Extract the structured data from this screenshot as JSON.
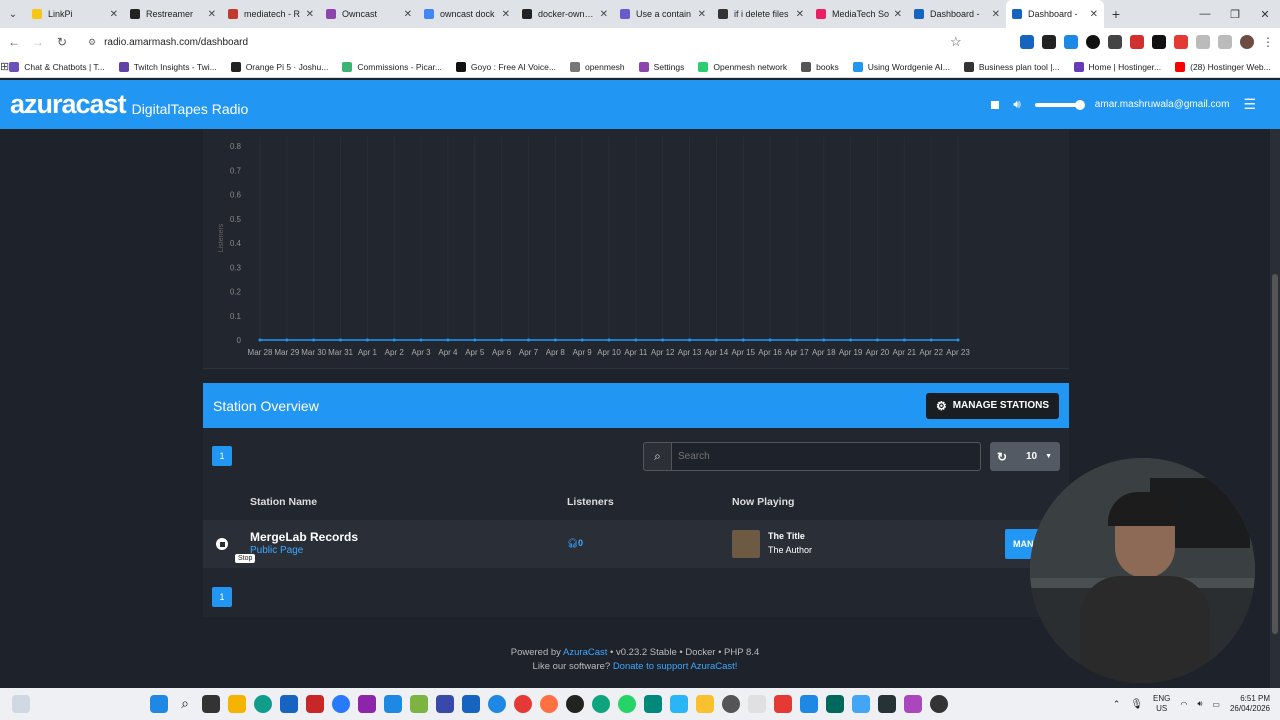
{
  "browser": {
    "tabs": [
      {
        "label": "LinkPi",
        "color": "#f5c518"
      },
      {
        "label": "Restreamer",
        "color": "#222222"
      },
      {
        "label": "mediatech - R",
        "color": "#c0392b"
      },
      {
        "label": "Owncast",
        "color": "#8e44ad"
      },
      {
        "label": "owncast dock",
        "color": "#4285f4"
      },
      {
        "label": "docker-owncast",
        "color": "#222222"
      },
      {
        "label": "Use a contain",
        "color": "#6a5acd"
      },
      {
        "label": "if i delete files",
        "color": "#333333"
      },
      {
        "label": "MediaTech So",
        "color": "#e91e63"
      },
      {
        "label": "Dashboard -",
        "color": "#1565c0"
      },
      {
        "label": "Dashboard -",
        "color": "#1565c0"
      }
    ],
    "url": "radio.amarmash.com/dashboard",
    "bookmarks": [
      {
        "label": "Chat & Chatbots | T...",
        "color": "#6b4fbb"
      },
      {
        "label": "Twitch Insights - Twi...",
        "color": "#6441a5"
      },
      {
        "label": "Orange Pi 5 · Joshu...",
        "color": "#222222"
      },
      {
        "label": "Commissions - Picar...",
        "color": "#3cb371"
      },
      {
        "label": "Goyo : Free AI Voice...",
        "color": "#111111"
      },
      {
        "label": "openmesh",
        "color": "#777777"
      },
      {
        "label": "Settings",
        "color": "#8e44ad"
      },
      {
        "label": "Openmesh network",
        "color": "#2ecc71"
      },
      {
        "label": "books",
        "color": "#555555"
      },
      {
        "label": "Using Wordgenie AI...",
        "color": "#2196f3"
      },
      {
        "label": "Business plan tool |...",
        "color": "#333333"
      },
      {
        "label": "Home | Hostinger...",
        "color": "#673ab7"
      },
      {
        "label": "(28) Hostinger Web...",
        "color": "#ff0000"
      }
    ]
  },
  "header": {
    "logo": "azuracast",
    "station": "DigitalTapes Radio",
    "user_email": "amar.mashruwala@gmail.com",
    "volume_level": 0.85
  },
  "chart_data": {
    "type": "line",
    "ylabel": "Listeners",
    "ylim": [
      0,
      0.8
    ],
    "yticks": [
      "0.8",
      "0.7",
      "0.6",
      "0.5",
      "0.4",
      "0.3",
      "0.2",
      "0.1",
      "0"
    ],
    "categories": [
      "Mar 28",
      "Mar 29",
      "Mar 30",
      "Mar 31",
      "Apr 1",
      "Apr 2",
      "Apr 3",
      "Apr 4",
      "Apr 5",
      "Apr 6",
      "Apr 7",
      "Apr 8",
      "Apr 9",
      "Apr 10",
      "Apr 11",
      "Apr 12",
      "Apr 13",
      "Apr 14",
      "Apr 15",
      "Apr 16",
      "Apr 17",
      "Apr 18",
      "Apr 19",
      "Apr 20",
      "Apr 21",
      "Apr 22",
      "Apr 23"
    ],
    "series": [
      {
        "values": [
          0,
          0,
          0,
          0,
          0,
          0,
          0,
          0,
          0,
          0,
          0,
          0,
          0,
          0,
          0,
          0,
          0,
          0,
          0,
          0,
          0,
          0,
          0,
          0,
          0,
          0,
          0
        ],
        "color": "#2196f3"
      }
    ]
  },
  "overview": {
    "title": "Station Overview",
    "manage_label": "MANAGE STATIONS",
    "page": "1",
    "search_placeholder": "Search",
    "per_page": "10",
    "columns": {
      "name": "Station Name",
      "listeners": "Listeners",
      "now_playing": "Now Playing"
    },
    "station": {
      "name": "MergeLab Records",
      "public_page": "Public Page",
      "listeners": "0",
      "song_title": "The Title",
      "song_artist": "The Author",
      "manage_btn": "MAN",
      "tooltip": "Stop"
    }
  },
  "footer": {
    "powered_by": "Powered by",
    "azuracast_link": "AzuraCast",
    "version": "• v0.23.2 Stable • Docker • PHP 8.4",
    "like": "Like our software?",
    "donate": "Donate to support AzuraCast!"
  },
  "taskbar": {
    "lang": "ENG",
    "region": "US",
    "time": "6:51 PM",
    "date": "26/04/2026"
  }
}
